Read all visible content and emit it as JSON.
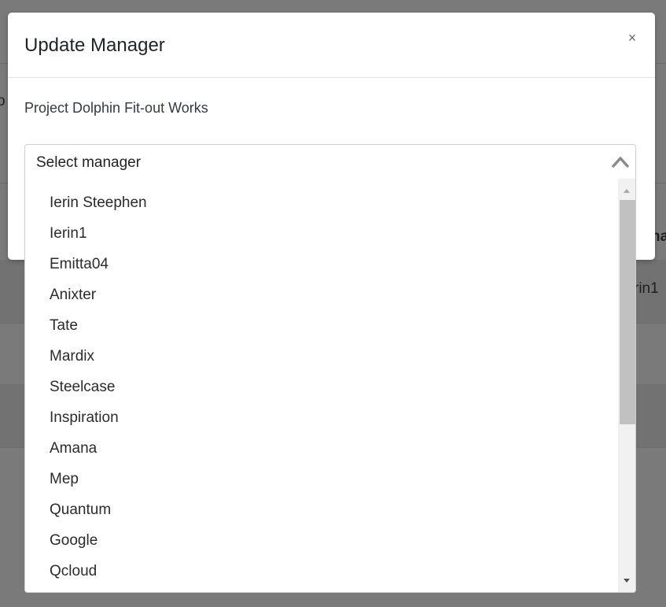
{
  "modal": {
    "title": "Update Manager",
    "close_label": "×",
    "project_name": "Project Dolphin Fit-out Works"
  },
  "select": {
    "placeholder": "Select manager",
    "options": [
      "Ierin Steephen",
      "Ierin1",
      "Emitta04",
      "Anixter",
      "Tate",
      "Mardix",
      "Steelcase",
      "Inspiration",
      "Amana",
      "Mep",
      "Quantum",
      "Google",
      "Qcloud"
    ]
  },
  "background": {
    "left_fragment": "o",
    "right_header_fragment": "na",
    "right_cell_fragment": "rin1"
  },
  "icons": {
    "close": "close-icon",
    "select_chevron": "chevron-up-icon",
    "scroll_up": "scroll-up-arrow-icon",
    "scroll_down": "scroll-down-arrow-icon"
  },
  "colors": {
    "overlay": "#7a7a7a",
    "modal_bg": "#ffffff",
    "text": "#212529",
    "scrollbar_track": "#f1f1f1",
    "scrollbar_thumb": "#c1c1c1"
  }
}
